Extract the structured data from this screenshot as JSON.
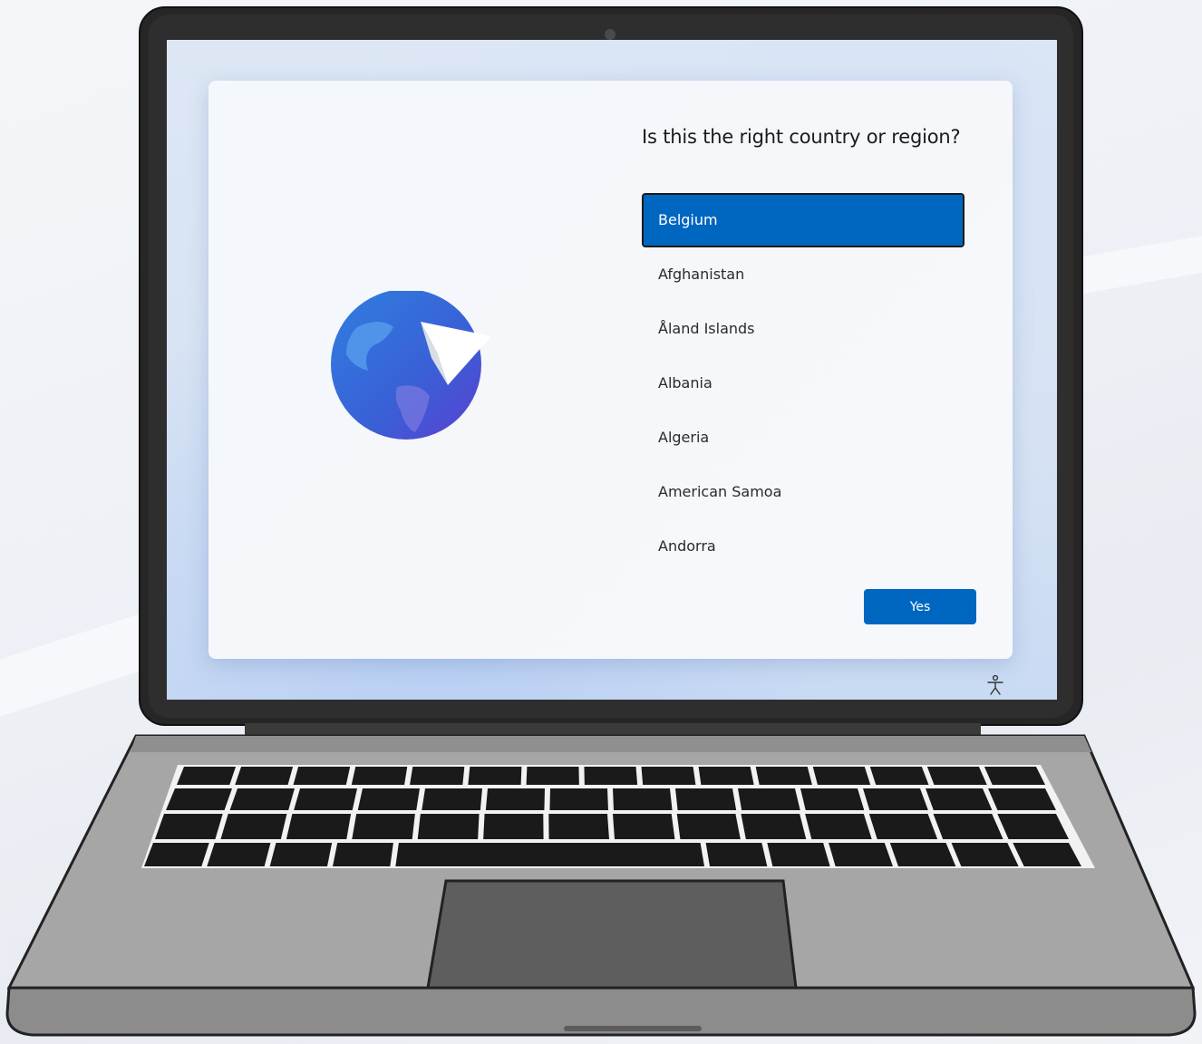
{
  "setup": {
    "title": "Is this the right country or region?",
    "countries": [
      {
        "label": "Belgium",
        "selected": true
      },
      {
        "label": "Afghanistan",
        "selected": false
      },
      {
        "label": "Åland Islands",
        "selected": false
      },
      {
        "label": "Albania",
        "selected": false
      },
      {
        "label": "Algeria",
        "selected": false
      },
      {
        "label": "American Samoa",
        "selected": false
      },
      {
        "label": "Andorra",
        "selected": false
      }
    ],
    "yes_label": "Yes"
  },
  "icons": {
    "illustration": "globe-with-paper-plane-icon",
    "accessibility": "accessibility-icon"
  },
  "colors": {
    "accent": "#0067c0",
    "laptop_bezel": "#2b2b2b",
    "laptop_body": "#a9a9a9",
    "keys": "#1a1a1a"
  }
}
